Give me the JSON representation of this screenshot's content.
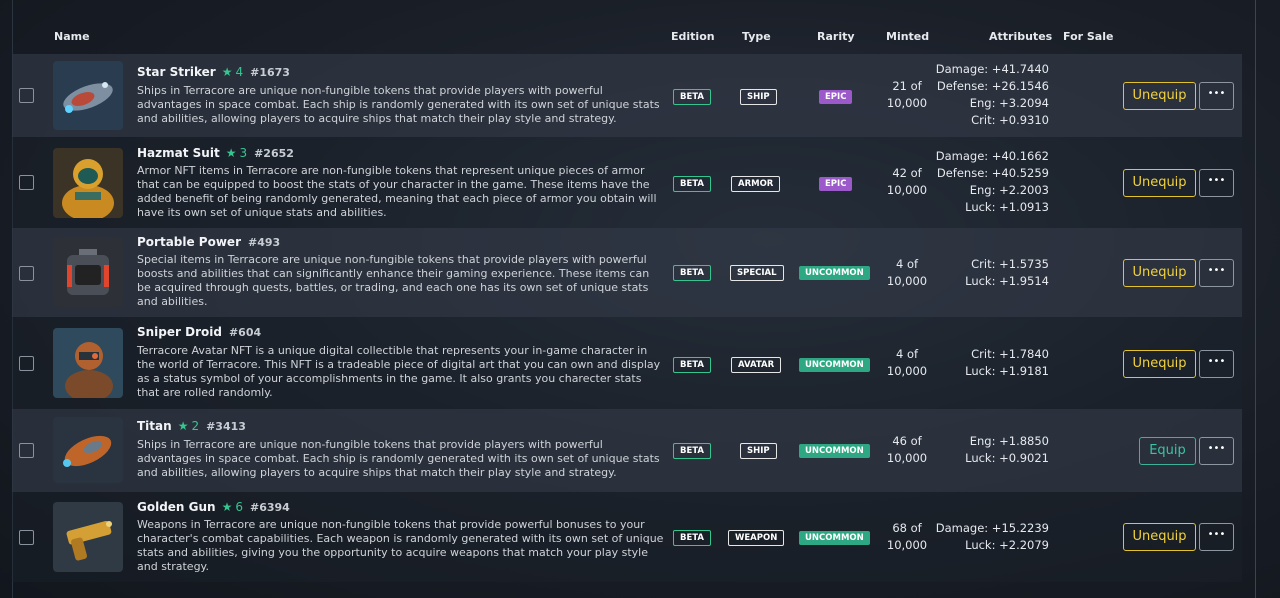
{
  "header": {
    "name": "Name",
    "edition": "Edition",
    "type": "Type",
    "rarity": "Rarity",
    "minted": "Minted",
    "attributes": "Attributes",
    "for_sale": "For Sale"
  },
  "icons": {
    "star": "star-icon",
    "more": "ellipsis-icon"
  },
  "colors": {
    "accent_green": "#35c58f",
    "unequip_yellow": "#e2c22d",
    "equip_teal": "#3ab39a",
    "epic_purple": "#9b59c9",
    "uncommon_green": "#2ea882"
  },
  "rows": [
    {
      "name": "Star Striker",
      "star": "★",
      "level": "4",
      "id": "#1673",
      "description": "Ships in Terracore are unique non-fungible tokens that provide players with powerful advantages in space combat. Each ship is randomly generated with its own set of unique stats and abilities, allowing players to acquire ships that match their play style and strategy.",
      "edition": "BETA",
      "type": "SHIP",
      "rarity": "EPIC",
      "minted_count": "21 of",
      "minted_total": "10,000",
      "attributes": [
        "Damage: +41.7440",
        "Defense: +26.1546",
        "Eng: +3.2094",
        "Crit: +0.9310"
      ],
      "action": "Unequip",
      "more": "•••"
    },
    {
      "name": "Hazmat Suit",
      "star": "★",
      "level": "3",
      "id": "#2652",
      "description": "Armor NFT items in Terracore are non-fungible tokens that represent unique pieces of armor that can be equipped to boost the stats of your character in the game. These items have the added benefit of being randomly generated, meaning that each piece of armor you obtain will have its own set of unique stats and abilities.",
      "edition": "BETA",
      "type": "ARMOR",
      "rarity": "EPIC",
      "minted_count": "42 of",
      "minted_total": "10,000",
      "attributes": [
        "Damage: +40.1662",
        "Defense: +40.5259",
        "Eng: +2.2003",
        "Luck: +1.0913"
      ],
      "action": "Unequip",
      "more": "•••"
    },
    {
      "name": "Portable Power",
      "star": "",
      "level": "",
      "id": "#493",
      "description": "Special items in Terracore are unique non-fungible tokens that provide players with powerful boosts and abilities that can significantly enhance their gaming experience. These items can be acquired through quests, battles, or trading, and each one has its own set of unique stats and abilities.",
      "edition": "BETA",
      "type": "SPECIAL",
      "rarity": "UNCOMMON",
      "minted_count": "4 of",
      "minted_total": "10,000",
      "attributes": [
        "Crit: +1.5735",
        "Luck: +1.9514"
      ],
      "action": "Unequip",
      "more": "•••"
    },
    {
      "name": "Sniper Droid",
      "star": "",
      "level": "",
      "id": "#604",
      "description": "Terracore Avatar NFT is a unique digital collectible that represents your in-game character in the world of Terracore. This NFT is a tradeable piece of digital art that you can own and display as a status symbol of your accomplishments in the game. It also grants you charecter stats that are rolled randomly.",
      "edition": "BETA",
      "type": "AVATAR",
      "rarity": "UNCOMMON",
      "minted_count": "4 of",
      "minted_total": "10,000",
      "attributes": [
        "Crit: +1.7840",
        "Luck: +1.9181"
      ],
      "action": "Unequip",
      "more": "•••"
    },
    {
      "name": "Titan",
      "star": "★",
      "level": "2",
      "id": "#3413",
      "description": "Ships in Terracore are unique non-fungible tokens that provide players with powerful advantages in space combat. Each ship is randomly generated with its own set of unique stats and abilities, allowing players to acquire ships that match their play style and strategy.",
      "edition": "BETA",
      "type": "SHIP",
      "rarity": "UNCOMMON",
      "minted_count": "46 of",
      "minted_total": "10,000",
      "attributes": [
        "Eng: +1.8850",
        "Luck: +0.9021"
      ],
      "action": "Equip",
      "more": "•••"
    },
    {
      "name": "Golden Gun",
      "star": "★",
      "level": "6",
      "id": "#6394",
      "description": "Weapons in Terracore are unique non-fungible tokens that provide powerful bonuses to your character's combat capabilities. Each weapon is randomly generated with its own set of unique stats and abilities, giving you the opportunity to acquire weapons that match your play style and strategy.",
      "edition": "BETA",
      "type": "WEAPON",
      "rarity": "UNCOMMON",
      "minted_count": "68 of",
      "minted_total": "10,000",
      "attributes": [
        "Damage: +15.2239",
        "Luck: +2.2079"
      ],
      "action": "Unequip",
      "more": "•••"
    }
  ]
}
